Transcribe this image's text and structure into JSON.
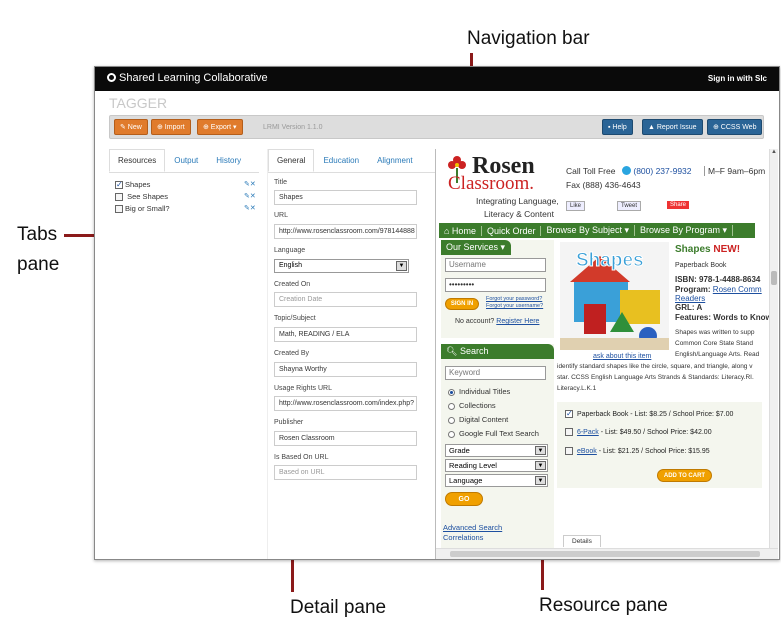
{
  "annotations": {
    "navigation_bar": "Navigation bar",
    "tabs_pane_line1": "Tabs",
    "tabs_pane_line2": "pane",
    "detail_pane": "Detail pane",
    "resource_pane": "Resource pane"
  },
  "app": {
    "brand": "Shared Learning Collaborative",
    "signin": "Sign in with Slc",
    "title": "TAGGER",
    "version": "LRMI Version 1.1.0"
  },
  "toolbar": {
    "new_label": "✎ New",
    "import_label": "⊕ Import",
    "export_label": "⊕ Export ▾",
    "help_label": "▪ Help",
    "report_label": "▲ Report Issue",
    "ccss_label": "⊕ CCSS Web"
  },
  "tabs_pane": {
    "tabs": [
      "Resources",
      "Output",
      "History"
    ],
    "resources": [
      {
        "label": "Shapes",
        "checked": true
      },
      {
        "label": "See Shapes",
        "checked": false
      },
      {
        "label": "Big or Small?",
        "checked": false
      }
    ],
    "row_actions": "✎✕"
  },
  "detail_pane": {
    "tabs": [
      "General",
      "Education",
      "Alignment"
    ],
    "fields": [
      {
        "label": "Title",
        "value": "Shapes",
        "placeholder": false
      },
      {
        "label": "URL",
        "value": "http://www.rosenclassroom.com/978144888",
        "placeholder": false
      },
      {
        "label": "Language",
        "value": "English",
        "select": true
      },
      {
        "label": "Created On",
        "value": "Creation Date",
        "placeholder": true
      },
      {
        "label": "Topic/Subject",
        "value": "Math, READING / ELA",
        "placeholder": false
      },
      {
        "label": "Created By",
        "value": "Shayna Worthy",
        "placeholder": false
      },
      {
        "label": "Usage Rights URL",
        "value": "http://www.rosenclassroom.com/index.php?",
        "placeholder": false
      },
      {
        "label": "Publisher",
        "value": "Rosen Classroom",
        "placeholder": false
      },
      {
        "label": "Is Based On URL",
        "value": "Based on URL",
        "placeholder": true
      }
    ]
  },
  "resource_pane": {
    "logo_top": "Rosen",
    "logo_bottom": "Classroom.",
    "tagline1": "Integrating Language,",
    "tagline2": "Literacy & Content",
    "toll_free": "Call Toll Free",
    "phone": "(800) 237-9932",
    "hours": "M–F 9am–6pm",
    "fax": "Fax (888) 436-4643",
    "like": "Like",
    "tweet": "Tweet",
    "share": "Share",
    "nav": [
      "⌂ Home",
      "Quick Order",
      "Browse By Subject ▾",
      "Browse By Program ▾"
    ],
    "our_services": "Our Services ▾",
    "username_ph": "Username",
    "password_val": "•••••••••",
    "signin_btn": "SIGN IN",
    "forgot_pw": "Forgot your password?",
    "forgot_user": "Forgot your username?",
    "no_account": "No account?",
    "register": "Register Here",
    "search_head": "Search",
    "keyword_ph": "Keyword",
    "radios": [
      {
        "label": "Individual Titles",
        "on": true
      },
      {
        "label": "Collections",
        "on": false
      },
      {
        "label": "Digital Content",
        "on": false
      },
      {
        "label": "Google Full Text Search",
        "on": false
      }
    ],
    "selects": [
      "Grade",
      "Reading Level",
      "Language"
    ],
    "go_btn": "GO",
    "advanced_search": "Advanced Search",
    "correlations": "Correlations",
    "book_title": "Shapes",
    "book_new": "NEW!",
    "format": "Paperback Book",
    "isbn": "ISBN: 978-1-4488-8634",
    "program_label": "Program:",
    "program_val": "Rosen Comm",
    "program_val2": "Readers",
    "grl": "GRL: A",
    "features": "Features: Words to Know",
    "cover_title": "Shapes",
    "ask": "ask about this item",
    "desc1": "Shapes was written to supp",
    "desc2": "Common Core State Stand",
    "desc3": "English/Language Arts. Read",
    "desc4": "identify standard shapes like the circle, square, and triangle, along v",
    "desc5": "star. CCSS English Language Arts Strands & Standards: Literacy.RI.",
    "desc6": "Literacy.L.K.1",
    "price_rows": [
      {
        "name": "Paperback Book",
        "price": " - List: $8.25 / School Price: $7.00",
        "checked": true,
        "link": false
      },
      {
        "name": "6-Pack",
        "price": " - List: $49.50 / School Price: $42.00",
        "checked": false,
        "link": true
      },
      {
        "name": "eBook",
        "price": " - List: $21.25 / School Price: $15.95",
        "checked": false,
        "link": true
      }
    ],
    "add_to_cart": "ADD TO CART",
    "details_tab": "Details"
  }
}
